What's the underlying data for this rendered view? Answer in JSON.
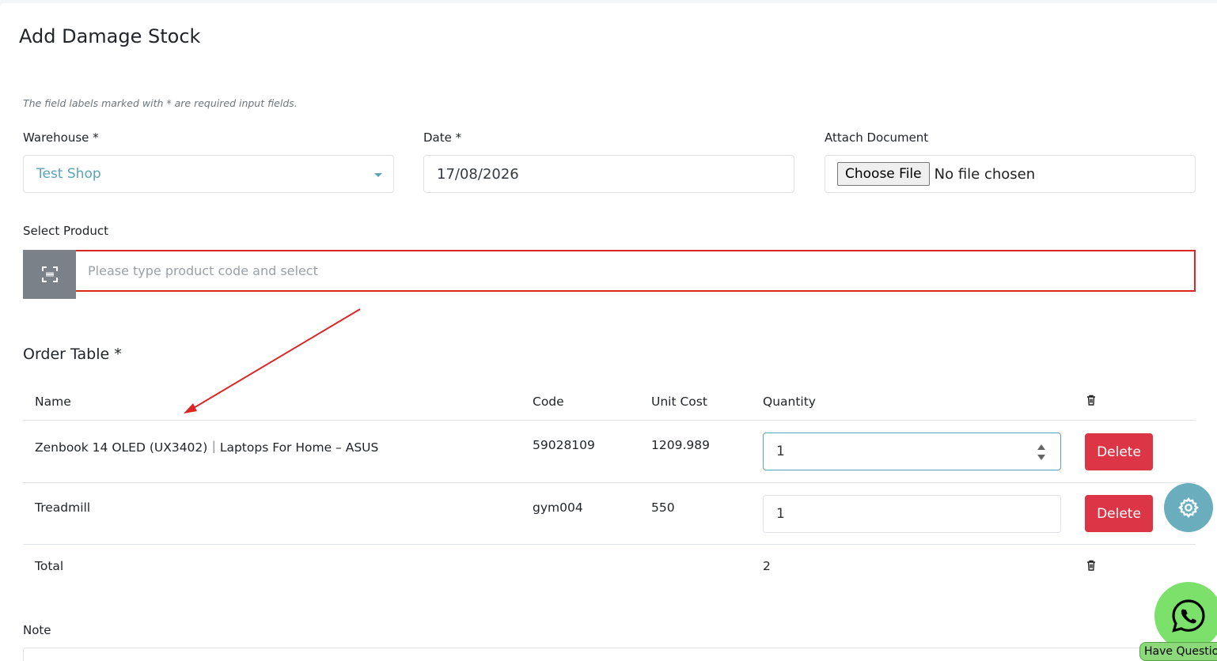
{
  "page": {
    "title": "Add Damage Stock",
    "required_note": "The field labels marked with * are required input fields."
  },
  "form": {
    "warehouse": {
      "label": "Warehouse *",
      "value": "Test Shop"
    },
    "date": {
      "label": "Date *",
      "value": "17/08/2026"
    },
    "attach": {
      "label": "Attach Document",
      "button": "Choose File",
      "status": "No file chosen"
    },
    "product": {
      "label": "Select Product",
      "placeholder": "Please type product code and select"
    }
  },
  "order_table": {
    "title": "Order Table *",
    "headers": {
      "name": "Name",
      "code": "Code",
      "unit_cost": "Unit Cost",
      "quantity": "Quantity"
    },
    "rows": [
      {
        "name": "Zenbook 14 OLED (UX3402)｜Laptops For Home – ASUS",
        "code": "59028109",
        "unit_cost": "1209.989",
        "quantity": "1",
        "delete_label": "Delete"
      },
      {
        "name": "Treadmill",
        "code": "gym004",
        "unit_cost": "550",
        "quantity": "1",
        "delete_label": "Delete"
      }
    ],
    "total": {
      "label": "Total",
      "quantity": "2"
    }
  },
  "note": {
    "label": "Note"
  },
  "widgets": {
    "whatsapp_label": "Have Questions?"
  },
  "colors": {
    "accent": "#5aa3b8",
    "danger": "#dc3545",
    "highlight": "#dc2626",
    "whatsapp": "#7be16a"
  }
}
